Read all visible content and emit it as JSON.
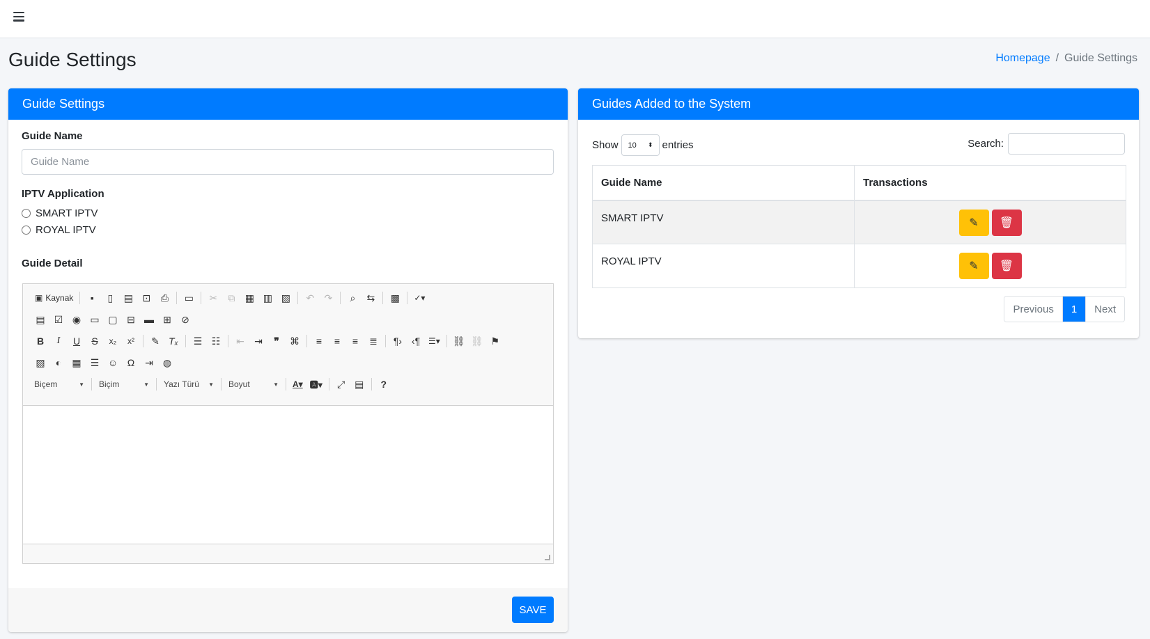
{
  "page": {
    "title": "Guide Settings"
  },
  "breadcrumb": {
    "home": "Homepage",
    "current": "Guide Settings"
  },
  "form": {
    "header": "Guide Settings",
    "guide_name_label": "Guide Name",
    "guide_name_placeholder": "Guide Name",
    "iptv_label": "IPTV Application",
    "iptv_options": [
      "SMART IPTV",
      "ROYAL IPTV"
    ],
    "detail_label": "Guide Detail",
    "save_label": "SAVE"
  },
  "editor": {
    "source_label": "Kaynak",
    "combos": [
      "Biçem",
      "Biçim",
      "Yazı Türü",
      "Boyut"
    ]
  },
  "list": {
    "header": "Guides Added to the System",
    "show_label": "Show",
    "entries_value": "10",
    "entries_label": "entries",
    "search_label": "Search:",
    "columns": [
      "Guide Name",
      "Transactions"
    ],
    "rows": [
      {
        "name": "SMART IPTV"
      },
      {
        "name": "ROYAL IPTV"
      }
    ],
    "pagination": {
      "previous": "Previous",
      "current": "1",
      "next": "Next"
    }
  },
  "colors": {
    "primary": "#007bff",
    "warning": "#ffc107",
    "danger": "#dc3545"
  }
}
